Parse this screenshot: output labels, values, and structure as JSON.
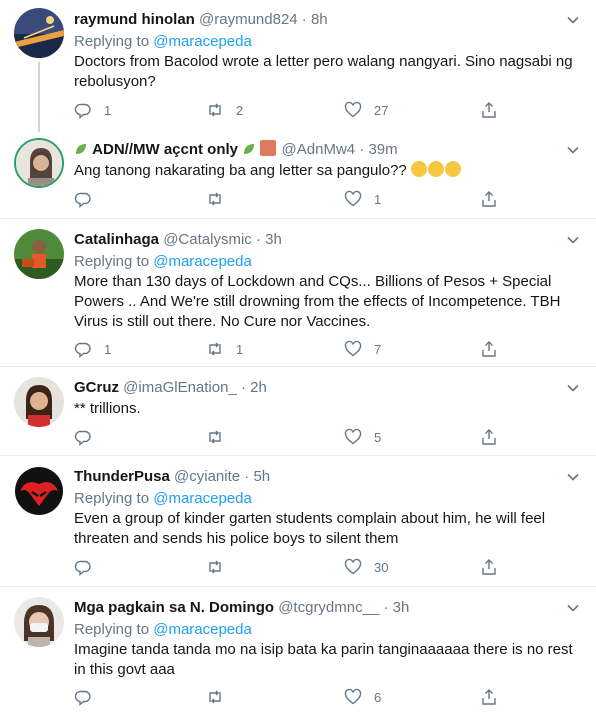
{
  "replying_label": "Replying to",
  "tweets": [
    {
      "name": "raymund hinolan",
      "handle": "@raymund824 · 8h",
      "replying_to": "@maracepeda",
      "text": "Doctors from Bacolod wrote a letter pero walang nangyari. Sino nagsabi ng rebolusyon?",
      "replies": "1",
      "retweets": "2",
      "likes": "27"
    },
    {
      "name": "ADN//MW açcnt only",
      "handle": "@AdnMw4 · 39m",
      "text": "Ang tanong nakarating ba ang letter sa pangulo??",
      "replies": "",
      "retweets": "",
      "likes": "1"
    },
    {
      "name": "Catalinhaga",
      "handle": "@Catalysmic · 3h",
      "text": "More than 130 days of Lockdown and CQs... Billions of Pesos + Special Powers .. And We're still drowning from the effects of Incompetence. TBH Virus is still out there. No Cure nor Vaccines.",
      "replies": "1",
      "retweets": "1",
      "likes": "7"
    },
    {
      "name": "GCruz",
      "handle": "@imaGlEnation_ · 2h",
      "text": "** trillions.",
      "replies": "",
      "retweets": "",
      "likes": "5"
    },
    {
      "name": "ThunderPusa",
      "handle": "@cyianite · 5h",
      "replying_to": "@maracepeda",
      "text": "Even a group of kinder garten students complain about him, he will feel threaten and sends his police boys to silent them",
      "replies": "",
      "retweets": "",
      "likes": "30"
    },
    {
      "name": "Mga pagkain sa N. Domingo",
      "handle": "@tcgrydmnc__ · 3h",
      "replying_to": "@maracepeda",
      "text": "Imagine tanda tanda mo na isip bata ka parin tanginaaaaaa there is no rest in this govt aaa",
      "replies": "",
      "retweets": "",
      "likes": "6"
    }
  ],
  "colors": {
    "link": "#1da1f2",
    "muted": "#657786",
    "border": "#e6ecf0"
  }
}
